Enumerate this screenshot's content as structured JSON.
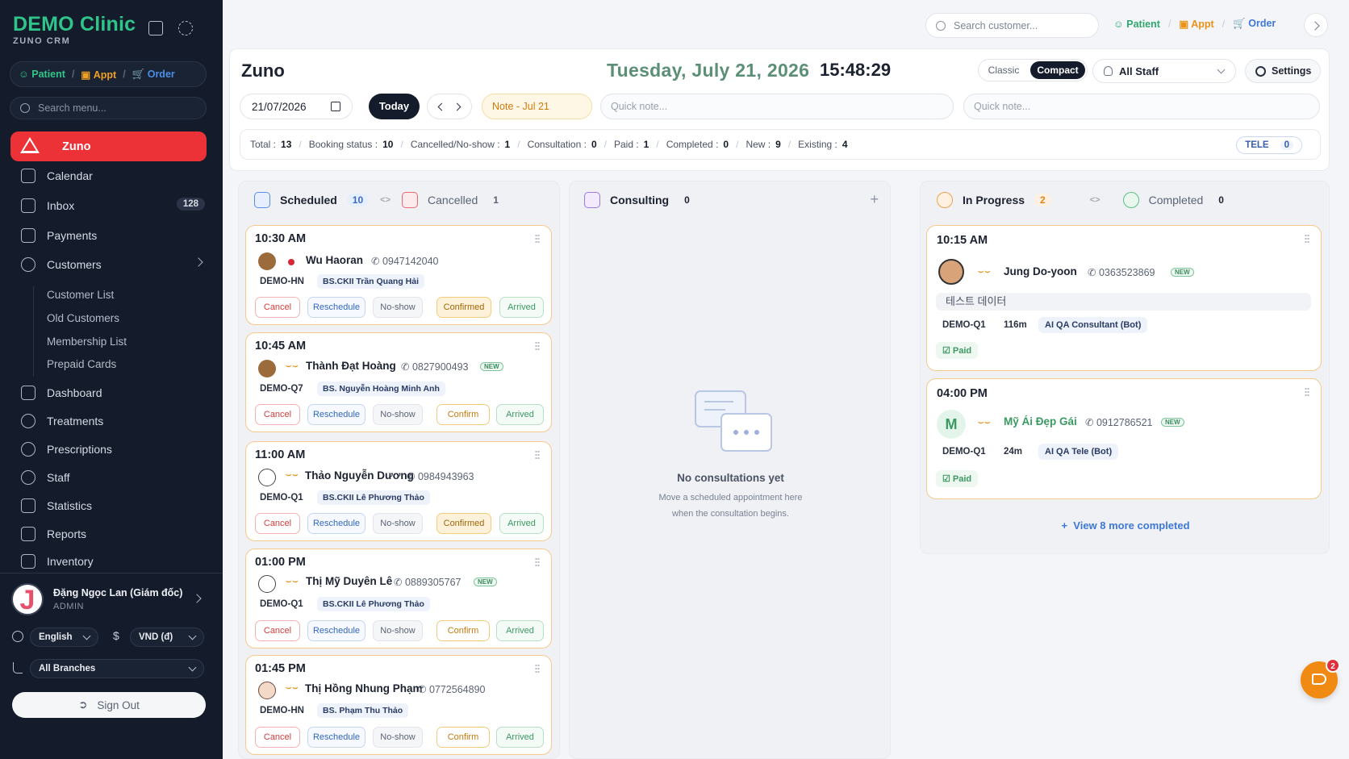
{
  "brand": {
    "title": "DEMO Clinic",
    "subtitle": "ZUNO CRM"
  },
  "quick": {
    "patient": "Patient",
    "appt": "Appt",
    "order": "Order",
    "sep": "/"
  },
  "sidebar": {
    "search_placeholder": "Search menu...",
    "active": "Zuno",
    "items": [
      {
        "label": "Calendar"
      },
      {
        "label": "Inbox",
        "badge": "128"
      },
      {
        "label": "Payments"
      },
      {
        "label": "Customers"
      },
      {
        "label": "Dashboard"
      },
      {
        "label": "Treatments"
      },
      {
        "label": "Prescriptions"
      },
      {
        "label": "Staff"
      },
      {
        "label": "Statistics"
      },
      {
        "label": "Reports"
      },
      {
        "label": "Inventory"
      }
    ],
    "sub_items": [
      "Customer List",
      "Old Customers",
      "Membership List",
      "Prepaid Cards"
    ],
    "user": {
      "initial": "J",
      "name": "Đặng Ngọc Lan (Giám đốc)",
      "role": "ADMIN"
    },
    "language": "English",
    "currency_symbol": "$",
    "currency": "VND (đ)",
    "branch": "All Branches",
    "sign_out": "Sign Out"
  },
  "topbar": {
    "search_placeholder": "Search customer...",
    "patient": "Patient",
    "appt": "Appt",
    "order": "Order"
  },
  "header": {
    "title": "Zuno",
    "date": "Tuesday, July 21, 2026",
    "time": "15:48:29",
    "view_classic": "Classic",
    "view_compact": "Compact",
    "staff": "All Staff",
    "settings": "Settings",
    "date_input": "21/07/2026",
    "today": "Today",
    "note": "Note - Jul 21",
    "quick_note_placeholder": "Quick note..."
  },
  "stats": [
    {
      "label": "Total :",
      "value": "13"
    },
    {
      "label": "Booking status :",
      "value": "10"
    },
    {
      "label": "Cancelled/No-show :",
      "value": "1"
    },
    {
      "label": "Consultation :",
      "value": "0"
    },
    {
      "label": "Paid :",
      "value": "1"
    },
    {
      "label": "Completed :",
      "value": "0"
    },
    {
      "label": "New :",
      "value": "9"
    },
    {
      "label": "Existing :",
      "value": "4"
    }
  ],
  "tele": {
    "label": "TELE",
    "value": "0"
  },
  "columns": {
    "scheduled": {
      "label": "Scheduled",
      "count": "10",
      "cancelled_label": "Cancelled",
      "cancelled_count": "1"
    },
    "consulting": {
      "label": "Consulting",
      "count": "0",
      "empty_title": "No consultations yet",
      "empty_line1": "Move a scheduled appointment here",
      "empty_line2": "when the consultation begins.",
      "add": "+"
    },
    "progress": {
      "label": "In Progress",
      "count": "2",
      "completed_label": "Completed",
      "completed_count": "0",
      "more": "View 8 more completed"
    }
  },
  "actions": {
    "cancel": "Cancel",
    "reschedule": "Reschedule",
    "noshow": "No-show",
    "confirmed": "Confirmed",
    "confirm": "Confirm",
    "arrived": "Arrived"
  },
  "appointments": [
    {
      "time": "10:30 AM",
      "name": "Wu Haoran",
      "phone": "0947142040",
      "branch": "DEMO-HN",
      "doctor": "BS.CKII Trần Quang Hải",
      "status": "Confirmed"
    },
    {
      "time": "10:45 AM",
      "name": "Thành Đạt Hoàng",
      "phone": "0827900493",
      "new": "NEW",
      "branch": "DEMO-Q7",
      "doctor": "BS. Nguyễn Hoàng Minh Anh",
      "status": "Confirm"
    },
    {
      "time": "11:00 AM",
      "name": "Thảo Nguyễn Dương",
      "phone": "0984943963",
      "branch": "DEMO-Q1",
      "doctor": "BS.CKII Lê Phương Thảo",
      "status": "Confirmed"
    },
    {
      "time": "01:00 PM",
      "name": "Thị Mỹ Duyên Lê",
      "phone": "0889305767",
      "new": "NEW",
      "branch": "DEMO-Q1",
      "doctor": "BS.CKII Lê Phương Thảo",
      "status": "Confirm"
    },
    {
      "time": "01:45 PM",
      "name": "Thị Hồng Nhung Phạm",
      "phone": "0772564890",
      "branch": "DEMO-HN",
      "doctor": "BS. Phạm Thu Thảo",
      "status": "Confirm"
    }
  ],
  "in_progress": [
    {
      "time": "10:15 AM",
      "name": "Jung Do-yoon",
      "phone": "0363523869",
      "new": "NEW",
      "memo": "테스트 데이터",
      "branch": "DEMO-Q1",
      "duration": "116m",
      "staff": "AI QA Consultant (Bot)",
      "paid": "Paid"
    },
    {
      "time": "04:00 PM",
      "initial": "M",
      "name": "Mỹ Ái Đẹp Gái",
      "phone": "0912786521",
      "new": "NEW",
      "branch": "DEMO-Q1",
      "duration": "24m",
      "staff": "AI QA Tele (Bot)",
      "paid": "Paid"
    }
  ],
  "fab_badge": "2",
  "colors": {
    "sidebar": "#141c2b",
    "active": "#ec3237",
    "brand": "#2fc48a",
    "accent_orange": "#f08a12"
  }
}
